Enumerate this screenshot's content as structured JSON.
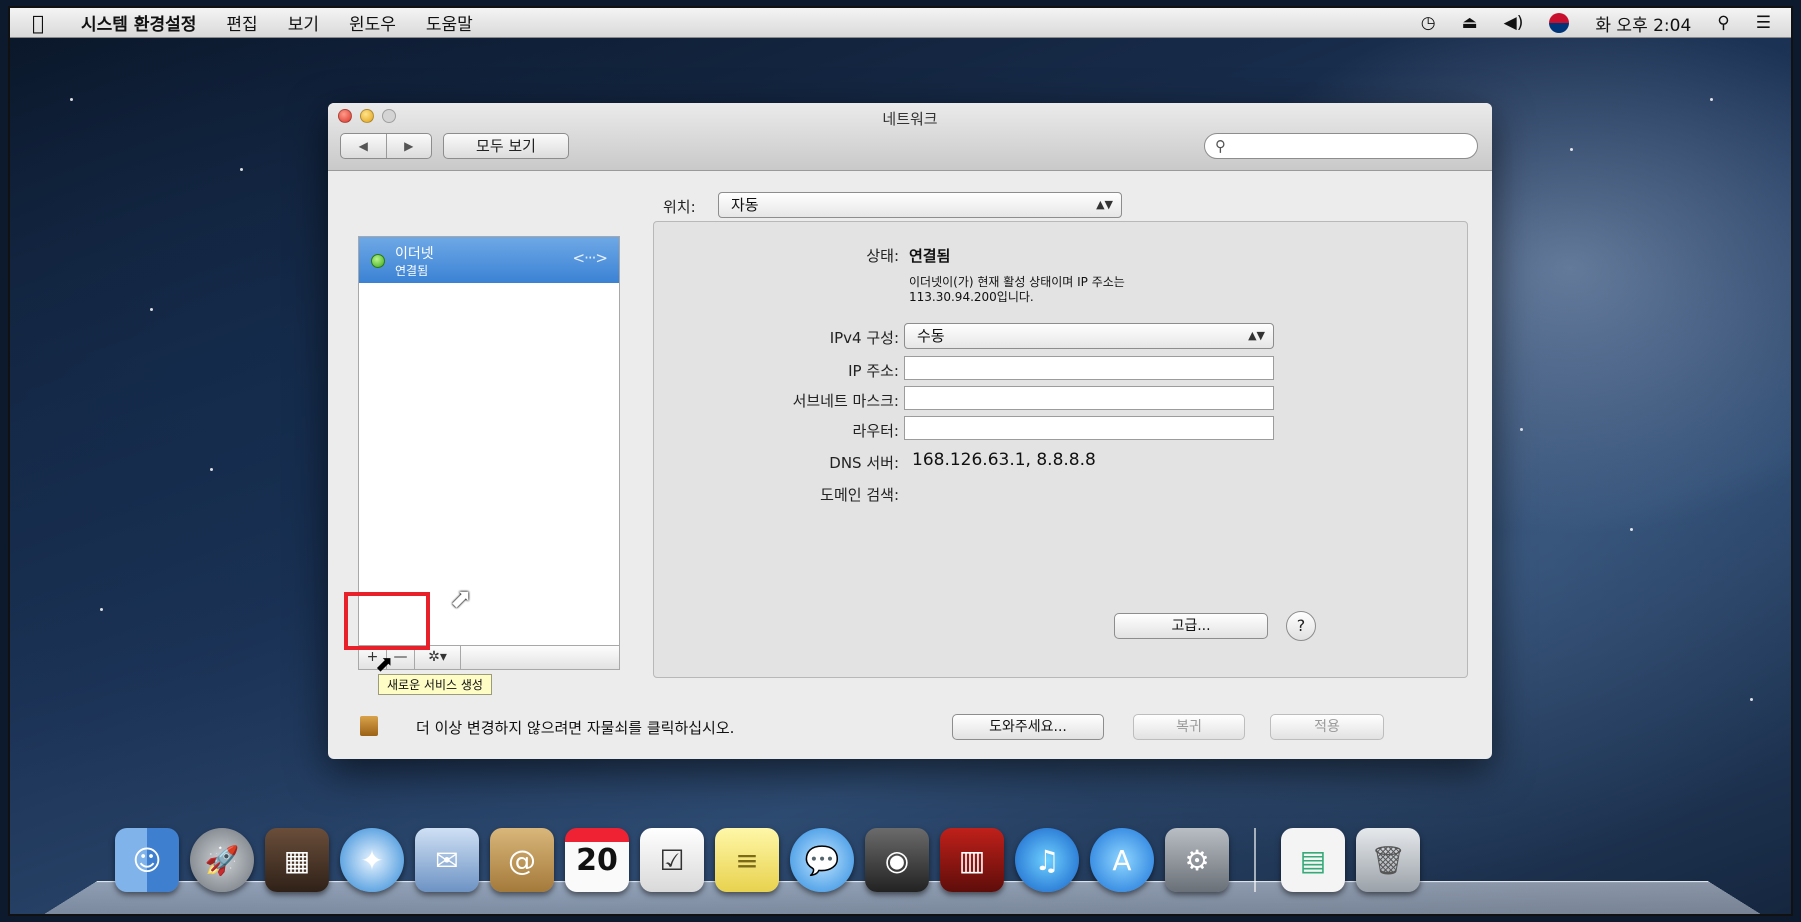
{
  "menubar": {
    "apple": "",
    "app_name": "시스템 환경설정",
    "items": [
      "편집",
      "보기",
      "윈도우",
      "도움말"
    ],
    "clock": "화 오후 2:04"
  },
  "window": {
    "title": "네트워크",
    "back": "◀",
    "forward": "▶",
    "show_all": "모두 보기",
    "search_placeholder": ""
  },
  "location": {
    "label": "위치:",
    "value": "자동"
  },
  "services": [
    {
      "name": "이더넷",
      "status": "연결됨"
    }
  ],
  "list_tools": {
    "add": "+",
    "remove": "—",
    "gear": "✲▾"
  },
  "tooltip": "새로운 서비스 생성",
  "detail": {
    "status_label": "상태:",
    "status_value": "연결됨",
    "status_desc_1": "이더넷이(가) 현재 활성 상태이며 IP 주소는",
    "status_desc_2": "113.30.94.200입니다.",
    "ipv4_label": "IPv4 구성:",
    "ipv4_value": "수동",
    "ip_label": "IP 주소:",
    "ip_value": "",
    "subnet_label": "서브네트 마스크:",
    "subnet_value": "",
    "router_label": "라우터:",
    "router_value": "",
    "dns_label": "DNS 서버:",
    "dns_value": "168.126.63.1, 8.8.8.8",
    "domain_label": "도메인 검색:",
    "advanced": "고급...",
    "help": "?"
  },
  "footer": {
    "lock_text": "더 이상 변경하지 않으려면 자물쇠를 클릭하십시오.",
    "assist": "도와주세요...",
    "revert": "복귀",
    "apply": "적용"
  },
  "dock": {
    "items": [
      "finder-icon",
      "launchpad-icon",
      "mission-control-icon",
      "safari-icon",
      "mail-icon",
      "contacts-icon",
      "calendar-icon",
      "reminders-icon",
      "notes-icon",
      "messages-icon",
      "facetime-icon",
      "photo-booth-icon",
      "itunes-icon",
      "app-store-icon",
      "system-preferences-icon",
      "preview-icon",
      "trash-icon"
    ],
    "calendar_day": "20"
  }
}
